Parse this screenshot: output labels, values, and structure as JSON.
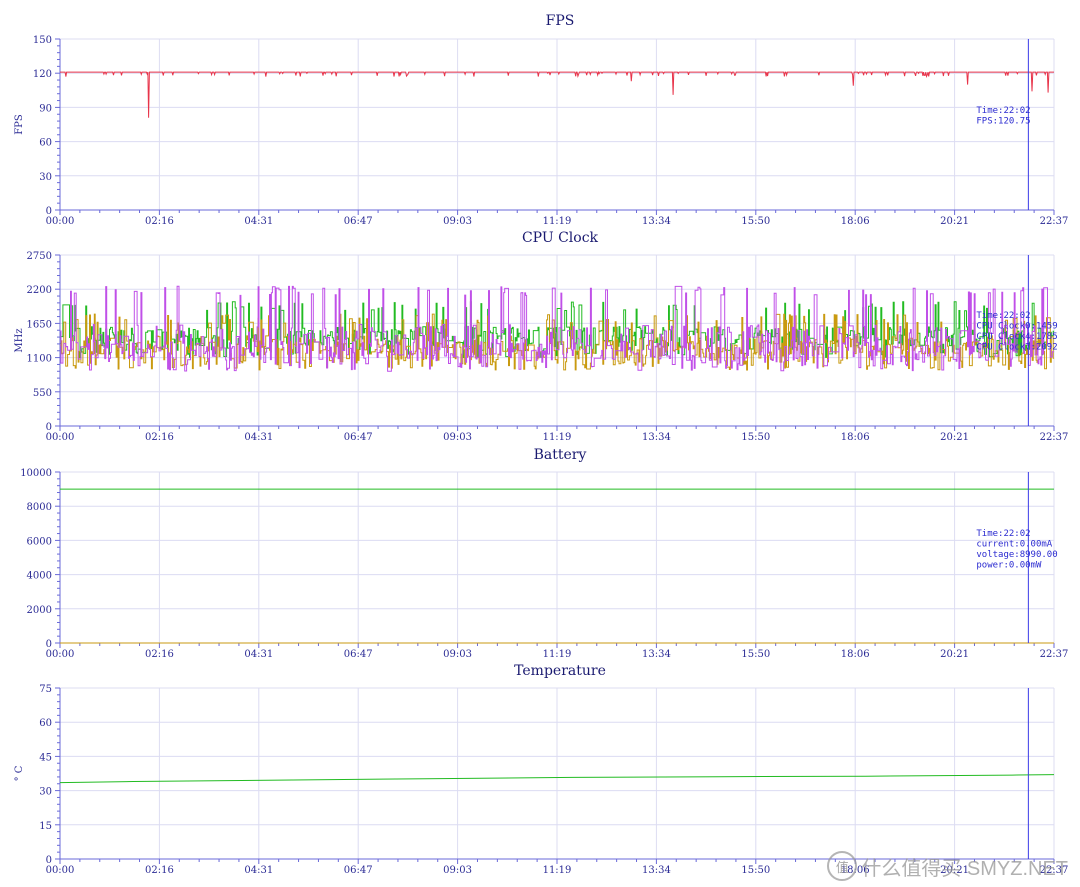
{
  "chart_data": [
    {
      "type": "line",
      "title": "FPS",
      "ylabel": "FPS",
      "ylim": [
        0,
        150
      ],
      "yticks": [
        "0",
        "30",
        "60",
        "90",
        "120",
        "150"
      ],
      "xticks": [
        "00:00",
        "02:16",
        "04:31",
        "06:47",
        "09:03",
        "11:19",
        "13:34",
        "15:50",
        "18:06",
        "20:21",
        "22:37"
      ],
      "xrange_min": [
        0,
        1357
      ],
      "grid": true,
      "cursor_min": 1322,
      "annotation": [
        "Time:22:02",
        "FPS:120.75"
      ],
      "series": [
        {
          "color": "#e8344a",
          "baseline": 121,
          "dips": [
            [
              8,
              117
            ],
            [
              121,
              81
            ],
            [
              141,
              118
            ],
            [
              780,
              113
            ],
            [
              837,
              101
            ],
            [
              1083,
              109
            ],
            [
              1239,
              110
            ],
            [
              1327,
              104
            ],
            [
              1349,
              103
            ]
          ]
        }
      ]
    },
    {
      "type": "line",
      "title": "CPU Clock",
      "ylabel": "MHz",
      "ylim": [
        0,
        2750
      ],
      "yticks": [
        "0",
        "550",
        "1100",
        "1650",
        "2200",
        "2750"
      ],
      "xticks": [
        "00:00",
        "02:16",
        "04:31",
        "06:47",
        "09:03",
        "11:19",
        "13:34",
        "15:50",
        "18:06",
        "20:21",
        "22:37"
      ],
      "xrange_min": [
        0,
        1357
      ],
      "grid": true,
      "cursor_min": 1322,
      "annotation": [
        "Time:22:02",
        "CPU Clock0:1459",
        "CPU Clock4:1785",
        "CPU Clock7:2092"
      ],
      "series": [
        {
          "color": "#22bb22",
          "range": [
            1100,
            2000
          ],
          "typical": 1450
        },
        {
          "color": "#c99a10",
          "range": [
            900,
            1800
          ],
          "typical": 1300
        },
        {
          "color": "#c050e8",
          "range": [
            880,
            2250
          ],
          "typical": 1200
        }
      ]
    },
    {
      "type": "line",
      "title": "Battery",
      "ylabel": "",
      "ylim": [
        0,
        10000
      ],
      "yticks": [
        "0",
        "2000",
        "4000",
        "6000",
        "8000",
        "10000"
      ],
      "xticks": [
        "00:00",
        "02:16",
        "04:31",
        "06:47",
        "09:03",
        "11:19",
        "13:34",
        "15:50",
        "18:06",
        "20:21",
        "22:37"
      ],
      "xrange_min": [
        0,
        1357
      ],
      "grid": true,
      "cursor_min": 1322,
      "annotation": [
        "Time:22:02",
        "current:0.00mA",
        "voltage:8990.00",
        "power:0.00mW"
      ],
      "series": [
        {
          "color": "#22bb22",
          "x": [
            0,
            1357
          ],
          "y": [
            9000,
            9000
          ]
        },
        {
          "color": "#c99a10",
          "x": [
            0,
            1357
          ],
          "y": [
            0,
            0
          ]
        }
      ]
    },
    {
      "type": "line",
      "title": "Temperature",
      "ylabel": "° C",
      "ylim": [
        0,
        75
      ],
      "yticks": [
        "0",
        "15",
        "30",
        "45",
        "60",
        "75"
      ],
      "xticks": [
        "00:00",
        "02:16",
        "04:31",
        "06:47",
        "09:03",
        "11:19",
        "13:34",
        "15:50",
        "18:06",
        "20:21",
        "22:37"
      ],
      "xrange_min": [
        0,
        1357
      ],
      "grid": true,
      "cursor_min": 1322,
      "annotation": [],
      "series": [
        {
          "color": "#22bb22",
          "x": [
            0,
            100,
            300,
            500,
            700,
            900,
            1100,
            1300,
            1357
          ],
          "y": [
            33.5,
            34,
            34.6,
            35.2,
            35.8,
            36.1,
            36.3,
            36.8,
            37
          ]
        }
      ]
    }
  ],
  "colors": {
    "axis": "#6a6ad8",
    "grid": "#dcdcf2",
    "cursor": "#3a3ae8",
    "text": "#2b2b95"
  },
  "watermark": {
    "logo": "值",
    "text": "什么值得买 SMYZ.NET"
  }
}
